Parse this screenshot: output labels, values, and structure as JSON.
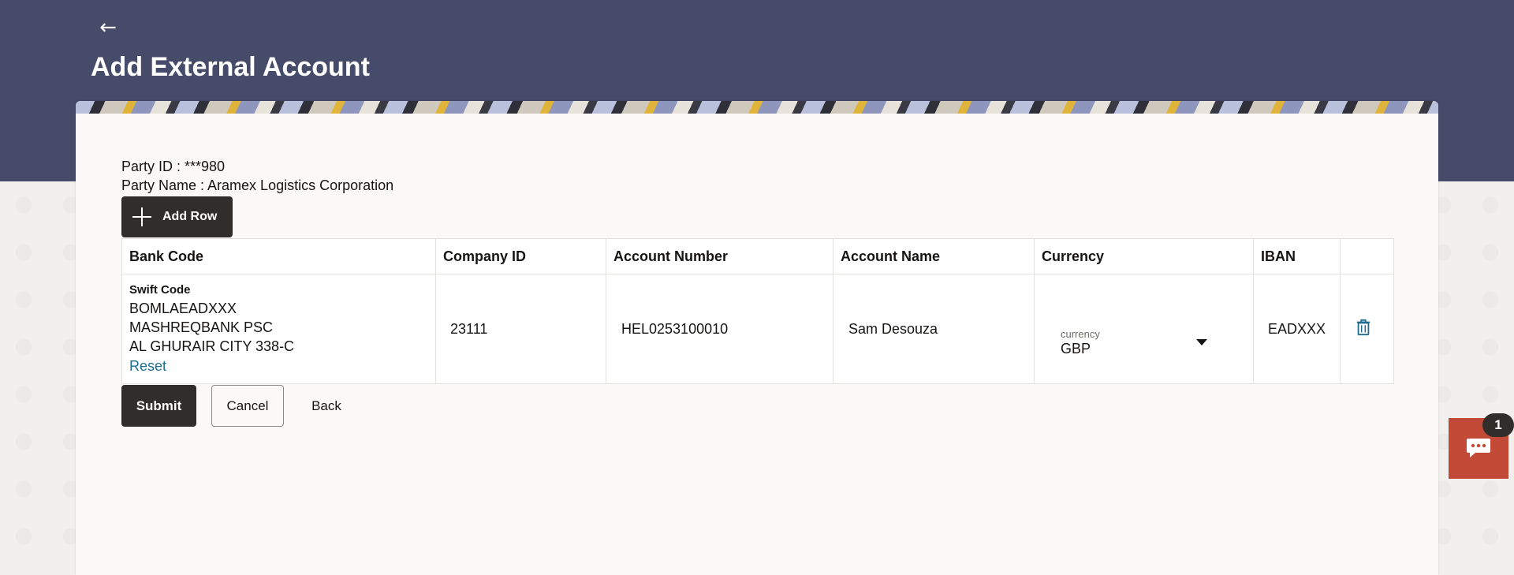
{
  "header": {
    "back_icon": "arrow-left-icon",
    "title": "Add External Account"
  },
  "party": {
    "id_line": "Party ID : ***980",
    "name_line": "Party Name : Aramex Logistics Corporation"
  },
  "toolbar": {
    "add_row_label": "Add Row",
    "add_row_icon": "plus-icon"
  },
  "table": {
    "headers": [
      "Bank Code",
      "Company ID",
      "Account Number",
      "Account Name",
      "Currency",
      "IBAN"
    ],
    "rows": [
      {
        "bank_code": {
          "label": "Swift Code",
          "code": "BOMLAEADXXX",
          "bank_name": "MASHREQBANK PSC",
          "address": "AL GHURAIR CITY 338-C",
          "reset_label": "Reset"
        },
        "company_id": "23111",
        "account_number": "HEL0253100010",
        "account_name": "Sam Desouza",
        "currency": {
          "label": "currency",
          "value": "GBP"
        },
        "iban": "EADXXX",
        "delete_icon": "trash-icon"
      }
    ]
  },
  "actions": {
    "submit_label": "Submit",
    "cancel_label": "Cancel",
    "back_label": "Back"
  },
  "chat": {
    "icon": "chat-bubble-icon",
    "badge_count": "1"
  },
  "colors": {
    "header_bg": "#474b6a",
    "primary_button": "#312d2a",
    "link": "#1f6b8e",
    "chat_widget": "#c34a37"
  }
}
